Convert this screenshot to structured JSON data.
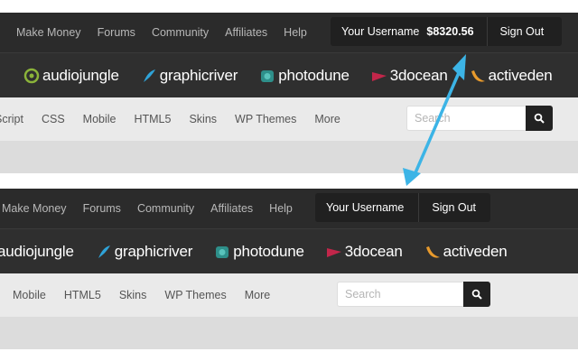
{
  "before": {
    "top_nav": [
      "Make Money",
      "Forums",
      "Community",
      "Affiliates",
      "Help"
    ],
    "user": {
      "username": "Your Username",
      "balance": "$8320.56",
      "sign_out": "Sign Out"
    },
    "markets": [
      {
        "name": "audiojungle",
        "icon": "audiojungle-logo-icon",
        "color": "#8bb33a"
      },
      {
        "name": "graphicriver",
        "icon": "graphicriver-logo-icon",
        "color": "#2fa3d8"
      },
      {
        "name": "photodune",
        "icon": "photodune-logo-icon",
        "color": "#3aa6a0"
      },
      {
        "name": "3docean",
        "icon": "3docean-logo-icon",
        "color": "#c2264a"
      },
      {
        "name": "activeden",
        "icon": "activeden-logo-icon",
        "color": "#e89a2c"
      }
    ],
    "categories": [
      "Script",
      "CSS",
      "Mobile",
      "HTML5",
      "Skins",
      "WP Themes",
      "More"
    ],
    "search_placeholder": "Search"
  },
  "after": {
    "top_nav": [
      "Make Money",
      "Forums",
      "Community",
      "Affiliates",
      "Help"
    ],
    "user": {
      "username": "Your Username",
      "sign_out": "Sign Out"
    },
    "markets": [
      {
        "name": "audiojungle",
        "icon": "audiojungle-logo-icon",
        "color": "#8bb33a"
      },
      {
        "name": "graphicriver",
        "icon": "graphicriver-logo-icon",
        "color": "#2fa3d8"
      },
      {
        "name": "photodune",
        "icon": "photodune-logo-icon",
        "color": "#3aa6a0"
      },
      {
        "name": "3docean",
        "icon": "3docean-logo-icon",
        "color": "#c2264a"
      },
      {
        "name": "activeden",
        "icon": "activeden-logo-icon",
        "color": "#e89a2c"
      }
    ],
    "categories": [
      "Mobile",
      "HTML5",
      "Skins",
      "WP Themes",
      "More"
    ],
    "search_placeholder": "Search"
  },
  "arrow_color": "#3cb4e6",
  "search_icon": "magnifier-icon"
}
